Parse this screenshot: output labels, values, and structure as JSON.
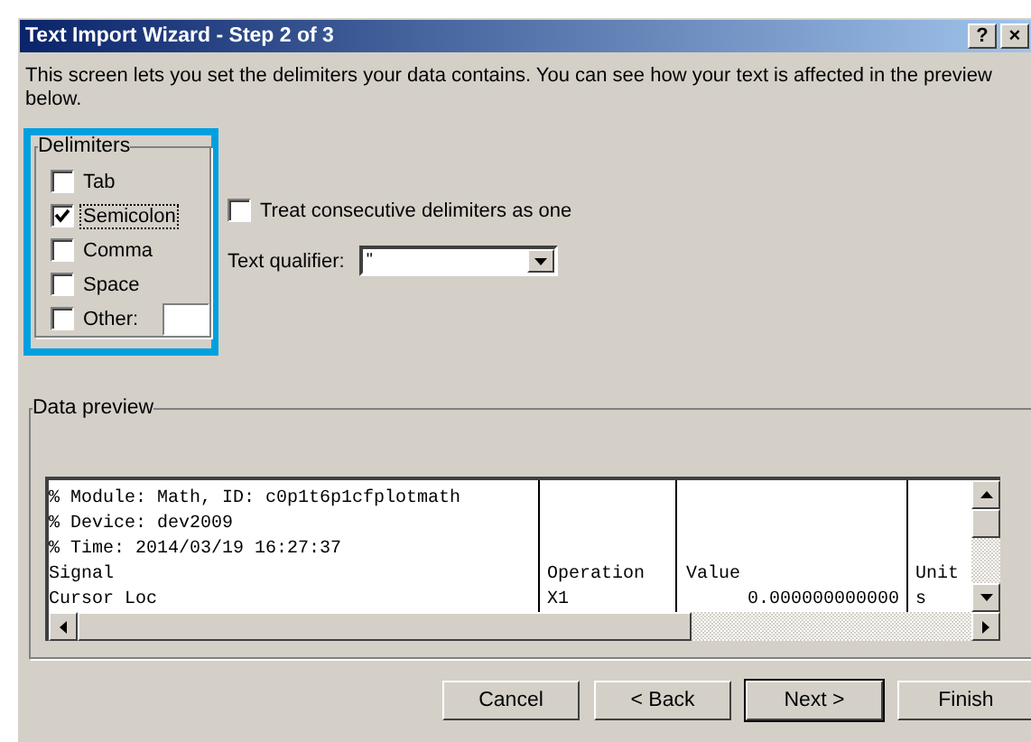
{
  "window": {
    "title": "Text Import Wizard - Step 2 of 3",
    "buttons": [
      "?",
      "×"
    ]
  },
  "description": "This screen lets you set the delimiters your data contains.  You can see how your text is affected in the preview below.",
  "delimiters": {
    "title": "Delimiters",
    "items": [
      {
        "label": "Tab",
        "checked": false,
        "kind": "plain"
      },
      {
        "label": "Semicolon",
        "checked": true,
        "kind": "plain"
      },
      {
        "label": "Comma",
        "checked": false,
        "kind": "plain"
      },
      {
        "label": "Space",
        "checked": false,
        "kind": "plain"
      },
      {
        "label": "Other:",
        "checked": false,
        "kind": "with-field"
      }
    ]
  },
  "consecutive": {
    "label": "Treat consecutive delimiters as one",
    "checked": false
  },
  "qualifier": {
    "label": "Text qualifier:",
    "value": "\""
  },
  "preview": {
    "title": "Data preview",
    "rows": [
      [
        "% Module: Math, ID: c0p1t6p1cfplotmath",
        "",
        "",
        ""
      ],
      [
        "% Device: dev2009",
        "",
        "",
        ""
      ],
      [
        "% Time: 2014/03/19 16:27:37",
        "",
        "",
        ""
      ],
      [
        "Signal",
        "Operation",
        "Value",
        "Unit"
      ],
      [
        "Cursor Loc",
        "X1",
        "0.000000000000",
        "s"
      ]
    ]
  },
  "buttons": [
    {
      "label": "Cancel",
      "default": false
    },
    {
      "label": "< Back",
      "default": false
    },
    {
      "label": "Next >",
      "default": true
    },
    {
      "label": "Finish",
      "default": false
    }
  ]
}
